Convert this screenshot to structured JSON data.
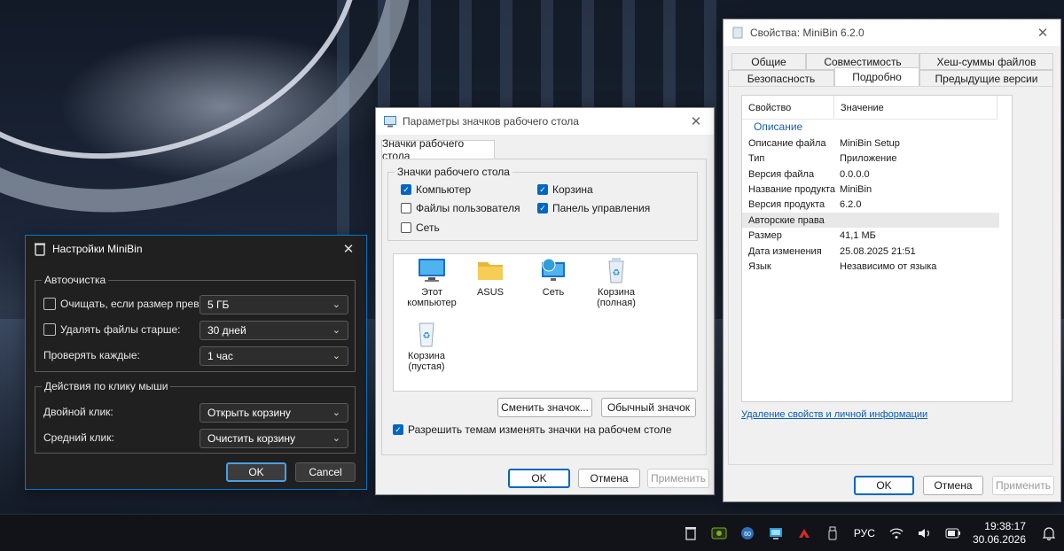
{
  "minibin_settings": {
    "title": "Настройки MiniBin",
    "autoclean": {
      "group_label": "Автоочистка",
      "clear_if_size_label": "Очищать, если размер превышает:",
      "clear_if_size_value": "5 ГБ",
      "delete_older_label": "Удалять файлы старше:",
      "delete_older_value": "30 дней",
      "check_every_label": "Проверять каждые:",
      "check_every_value": "1 час"
    },
    "click_actions": {
      "group_label": "Действия по клику мыши",
      "double_click_label": "Двойной клик:",
      "double_click_value": "Открыть корзину",
      "middle_click_label": "Средний клик:",
      "middle_click_value": "Очистить корзину"
    },
    "ok_label": "OK",
    "cancel_label": "Cancel"
  },
  "desktop_icons": {
    "title": "Параметры значков рабочего стола",
    "tab_label": "Значки рабочего стола",
    "group_label": "Значки рабочего стола",
    "checkboxes": [
      {
        "label": "Компьютер",
        "checked": true
      },
      {
        "label": "Корзина",
        "checked": true
      },
      {
        "label": "Файлы пользователя",
        "checked": false
      },
      {
        "label": "Панель управления",
        "checked": true
      },
      {
        "label": "Сеть",
        "checked": false
      }
    ],
    "icons": [
      {
        "label": "Этот компьютер",
        "icon": "monitor-icon"
      },
      {
        "label": "ASUS",
        "icon": "folder-icon"
      },
      {
        "label": "Сеть",
        "icon": "network-globe-icon"
      },
      {
        "label": "Корзина (полная)",
        "icon": "recycle-bin-full-icon"
      },
      {
        "label": "Корзина (пустая)",
        "icon": "recycle-bin-empty-icon"
      }
    ],
    "change_icon_label": "Сменить значок...",
    "default_icon_label": "Обычный значок",
    "allow_themes_label": "Разрешить темам изменять значки на рабочем столе",
    "allow_themes_checked": true,
    "ok_label": "OK",
    "cancel_label": "Отмена",
    "apply_label": "Применить"
  },
  "properties": {
    "title": "Свойства: MiniBin 6.2.0",
    "tabs_row1": [
      "Общие",
      "Совместимость",
      "Хеш-суммы файлов"
    ],
    "tabs_row2": [
      "Безопасность",
      "Подробно",
      "Предыдущие версии"
    ],
    "active_tab": "Подробно",
    "col_property": "Свойство",
    "col_value": "Значение",
    "section": "Описание",
    "rows": [
      {
        "k": "Описание файла",
        "v": "MiniBin Setup"
      },
      {
        "k": "Тип",
        "v": "Приложение"
      },
      {
        "k": "Версия файла",
        "v": "0.0.0.0"
      },
      {
        "k": "Название продукта",
        "v": "MiniBin"
      },
      {
        "k": "Версия продукта",
        "v": "6.2.0"
      },
      {
        "k": "Авторские права",
        "v": ""
      },
      {
        "k": "Размер",
        "v": "41,1 МБ"
      },
      {
        "k": "Дата изменения",
        "v": "25.08.2025 21:51"
      },
      {
        "k": "Язык",
        "v": "Независимо от языка"
      }
    ],
    "remove_link": "Удаление свойств и личной информации",
    "ok_label": "OK",
    "cancel_label": "Отмена",
    "apply_label": "Применить"
  },
  "taskbar": {
    "language": "РУС",
    "time": "19:38:17",
    "date": "30.06.2026"
  },
  "colors": {
    "accent": "#0067c0",
    "dark_dialog": "#202020"
  }
}
